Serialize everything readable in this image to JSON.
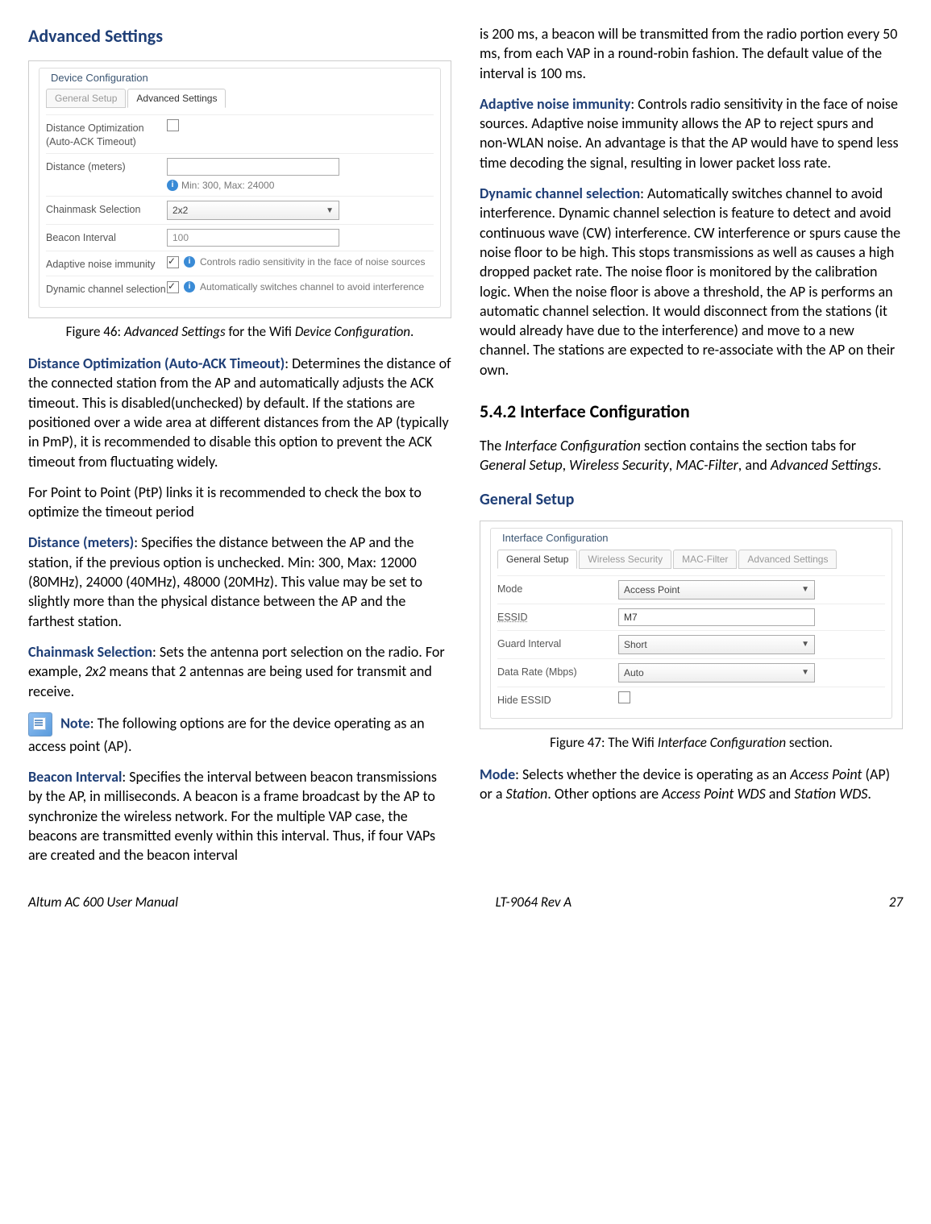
{
  "col1": {
    "heading_adv": "Advanced Settings",
    "fig46": {
      "panel_title": "Device Configuration",
      "tab_general": "General Setup",
      "tab_adv": "Advanced Settings",
      "row1_label": "Distance Optimization",
      "row1_sub": "(Auto-ACK Timeout)",
      "row2_label": "Distance (meters)",
      "row2_hint": "Min: 300, Max: 24000",
      "row3_label": "Chainmask Selection",
      "row3_val": "2x2",
      "row4_label": "Beacon Interval",
      "row4_val": "100",
      "row5_label": "Adaptive noise immunity",
      "row5_hint": "Controls radio sensitivity in the face of noise sources",
      "row6_label": "Dynamic channel selection",
      "row6_hint": "Automatically switches channel to avoid interference",
      "caption_a": "Figure 46: ",
      "caption_b": "Advanced Settings",
      "caption_c": " for the Wifi ",
      "caption_d": "Device Configuration",
      "caption_e": "."
    },
    "para_dist_opt_term": "Distance Optimization (Auto-ACK Timeout)",
    "para_dist_opt_body": ": Determines the distance of the connected station from the AP and automatically adjusts the ACK timeout. This is disabled(unchecked) by default. If the stations are positioned over a wide area at different distances from the AP (typically in PmP), it is recommended to disable this option to prevent the ACK timeout from fluctuating widely.",
    "para_ptp": "For Point to Point (PtP) links it is recommended to check the box to optimize the timeout period",
    "para_dist_term": "Distance (meters)",
    "para_dist_body": ": Specifies the distance between the AP and the station, if the previous option is unchecked. Min: 300, Max: 12000 (80MHz), 24000 (40MHz), 48000 (20MHz). This value may be set to slightly more than the physical distance between the AP and the farthest station.",
    "para_chain_term": "Chainmask Selection",
    "para_chain_body_a": ": Sets the antenna port selection on the radio. For example, ",
    "para_chain_body_b": "2x2",
    "para_chain_body_c": " means that 2 antennas are being used for transmit and receive.",
    "para_note_term": "Note",
    "para_note_body": ": The following options are for the device operating as an access point (AP).",
    "para_beacon_term": "Beacon Interval",
    "para_beacon_body": ": Specifies the interval between beacon transmissions by the AP, in milliseconds. A beacon is a frame broadcast by the AP to synchronize the wireless network. For the multiple VAP case, the beacons are transmitted evenly within this interval. Thus, if four VAPs are created and the beacon interval"
  },
  "col2": {
    "para_cont": "is 200 ms, a beacon will be transmitted from the radio portion every 50 ms, from each VAP in a round-robin fashion. The default value of the interval is 100 ms.",
    "para_ani_term": "Adaptive noise immunity",
    "para_ani_body": ": Controls radio sensitivity in the face of noise sources. Adaptive noise immunity allows the AP to reject spurs and non-WLAN noise. An advantage is that the AP would have to spend less time decoding the signal, resulting in lower packet loss rate.",
    "para_dcs_term": "Dynamic channel selection",
    "para_dcs_body": ": Automatically switches channel to avoid interference. Dynamic channel selection is feature to detect and avoid continuous wave (CW) interference. CW interference or spurs cause the noise floor to be high. This stops transmissions as well as causes a high dropped packet rate. The noise floor is monitored by the calibration logic. When the noise floor is above a threshold, the AP is performs an automatic channel selection. It would disconnect from the stations (it would already have due to the interference) and move to a new channel. The stations are expected to re-associate with the AP on their own.",
    "heading_542": "5.4.2 Interface Configuration",
    "para_intf_a": "The ",
    "para_intf_b": "Interface Configuration",
    "para_intf_c": " section contains the section tabs for ",
    "para_intf_d": "General Setup",
    "para_intf_e": ", ",
    "para_intf_f": "Wireless Security",
    "para_intf_g": ", ",
    "para_intf_h": "MAC-Filter",
    "para_intf_i": ", and ",
    "para_intf_j": "Advanced Settings",
    "para_intf_k": ".",
    "heading_gen": "General Setup",
    "fig47": {
      "panel_title": "Interface Configuration",
      "tab1": "General Setup",
      "tab2": "Wireless Security",
      "tab3": "MAC-Filter",
      "tab4": "Advanced Settings",
      "row1_label": "Mode",
      "row1_val": "Access Point",
      "row2_label": "ESSID",
      "row2_val": "M7",
      "row3_label": "Guard Interval",
      "row3_val": "Short",
      "row4_label": "Data Rate (Mbps)",
      "row4_val": "Auto",
      "row5_label": "Hide ESSID",
      "caption_a": "Figure 47: The Wifi ",
      "caption_b": "Interface Configuration",
      "caption_c": " section."
    },
    "para_mode_term": "Mode",
    "para_mode_a": ": Selects whether the device is operating as an ",
    "para_mode_b": "Access Point",
    "para_mode_c": " (AP) or a ",
    "para_mode_d": "Station",
    "para_mode_e": ". Other options are ",
    "para_mode_f": "Access Point WDS",
    "para_mode_g": " and ",
    "para_mode_h": "Station WDS",
    "para_mode_i": "."
  },
  "footer": {
    "left": "Altum AC 600 User Manual",
    "mid": "LT-9064 Rev A",
    "right": "27"
  }
}
